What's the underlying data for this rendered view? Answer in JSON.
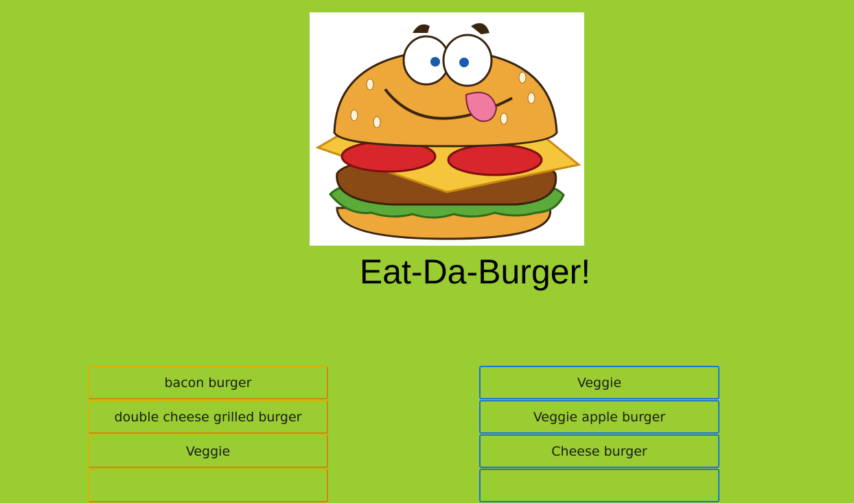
{
  "header": {
    "title": "Eat-Da-Burger!",
    "logo_icon": "burger-mascot-icon"
  },
  "colors": {
    "background": "#9acd32",
    "uneaten_border": "#d9b300",
    "devoured_border": "#1a73d9"
  },
  "uneaten": {
    "items": [
      {
        "label": "bacon burger"
      },
      {
        "label": "double cheese grilled burger"
      },
      {
        "label": "Veggie"
      }
    ]
  },
  "devoured": {
    "items": [
      {
        "label": "Veggie"
      },
      {
        "label": "Veggie apple burger"
      },
      {
        "label": "Cheese burger"
      }
    ]
  }
}
